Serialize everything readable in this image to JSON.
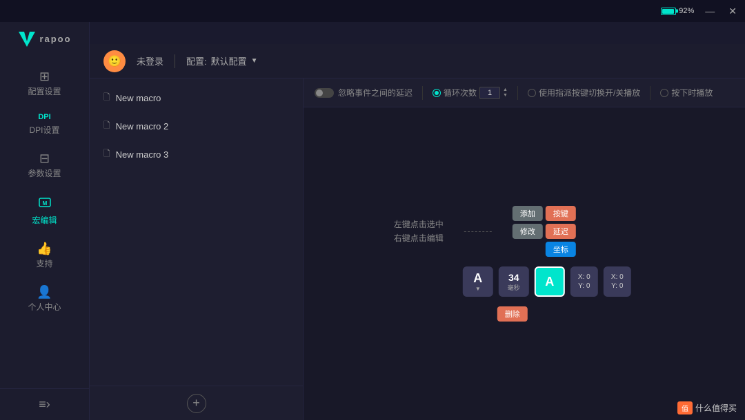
{
  "titlebar": {
    "battery_pct": "92%",
    "minimize_label": "—",
    "close_label": "✕"
  },
  "header": {
    "user_label": "未登录",
    "config_prefix": "配置:",
    "config_name": "默认配置"
  },
  "sidebar": {
    "logo": "rapoo",
    "items": [
      {
        "id": "config-settings",
        "label": "配置设置",
        "icon": "⊞"
      },
      {
        "id": "dpi-settings",
        "label": "DPI设置",
        "icon": "DPI"
      },
      {
        "id": "param-settings",
        "label": "参数设置",
        "icon": "⊟"
      },
      {
        "id": "macro-editor",
        "label": "宏编辑",
        "icon": "M",
        "active": true
      },
      {
        "id": "support",
        "label": "支持",
        "icon": "👍"
      },
      {
        "id": "personal",
        "label": "个人中心",
        "icon": "👤"
      }
    ],
    "bottom_icon": "≡›"
  },
  "macro_list": {
    "items": [
      {
        "name": "New macro",
        "active": false
      },
      {
        "name": "New macro 2",
        "active": false
      },
      {
        "name": "New macro 3",
        "active": false
      }
    ],
    "add_label": "+"
  },
  "toolbar": {
    "ignore_delay_label": "忽略事件之间的延迟",
    "loop_count_label": "循环次数",
    "loop_count_value": "1",
    "use_key_label": "使用指派按键切换开/关播放",
    "press_play_label": "按下时播放"
  },
  "canvas": {
    "instruction_line1": "左键点击选中",
    "instruction_line2": "右键点击编辑",
    "keys": [
      {
        "char": "A",
        "type": "gray"
      },
      {
        "delay": "34",
        "unit": "毫秒"
      },
      {
        "char": "A",
        "type": "teal-selected"
      },
      {
        "coord1": "X: 0",
        "coord2": "Y: 0"
      },
      {
        "coord1": "X: 0",
        "coord2": "Y: 0"
      }
    ],
    "context_menu": {
      "add_label": "添加",
      "modify_label": "修改",
      "key_label": "按键",
      "delay_label": "延迟",
      "coord_label": "坐标"
    },
    "delete_label": "删除"
  },
  "watermark": {
    "text": "什么值得买",
    "badge": "值"
  }
}
